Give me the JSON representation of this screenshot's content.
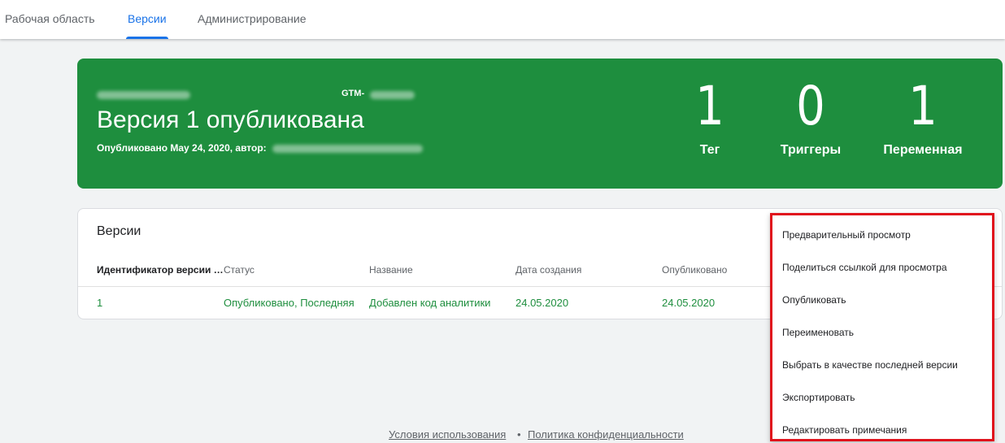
{
  "nav": {
    "tabs": [
      {
        "label": "Рабочая область"
      },
      {
        "label": "Версии",
        "active": true
      },
      {
        "label": "Администрирование"
      }
    ]
  },
  "hero": {
    "gtm_prefix": "GTM-",
    "title": "Версия 1 опубликована",
    "published_text": "Опубликовано May 24, 2020, автор:",
    "background_color": "#1e8e3e",
    "stats": [
      {
        "value": "1",
        "label": "Тег"
      },
      {
        "value": "0",
        "label": "Триггеры"
      },
      {
        "value": "1",
        "label": "Переменная"
      }
    ]
  },
  "versions": {
    "title": "Версии",
    "columns": [
      "Идентификатор версии …",
      "Статус",
      "Название",
      "Дата создания",
      "Опубликовано"
    ],
    "rows": [
      {
        "id": "1",
        "status": "Опубликовано, Последняя",
        "name": "Добавлен код аналитики",
        "created": "24.05.2020",
        "published": "24.05.2020"
      }
    ]
  },
  "context_menu": {
    "items": [
      "Предварительный просмотр",
      "Поделиться ссылкой для просмотра",
      "Опубликовать",
      "Переименовать",
      "Выбрать в качестве последней версии",
      "Экспортировать",
      "Редактировать примечания"
    ],
    "highlight_color": "#e0121c"
  },
  "footer": {
    "terms": "Условия использования",
    "separator": "•",
    "privacy": "Политика конфиденциальности"
  },
  "colors": {
    "accent": "#1a73e8",
    "success": "#1e8e3e"
  }
}
